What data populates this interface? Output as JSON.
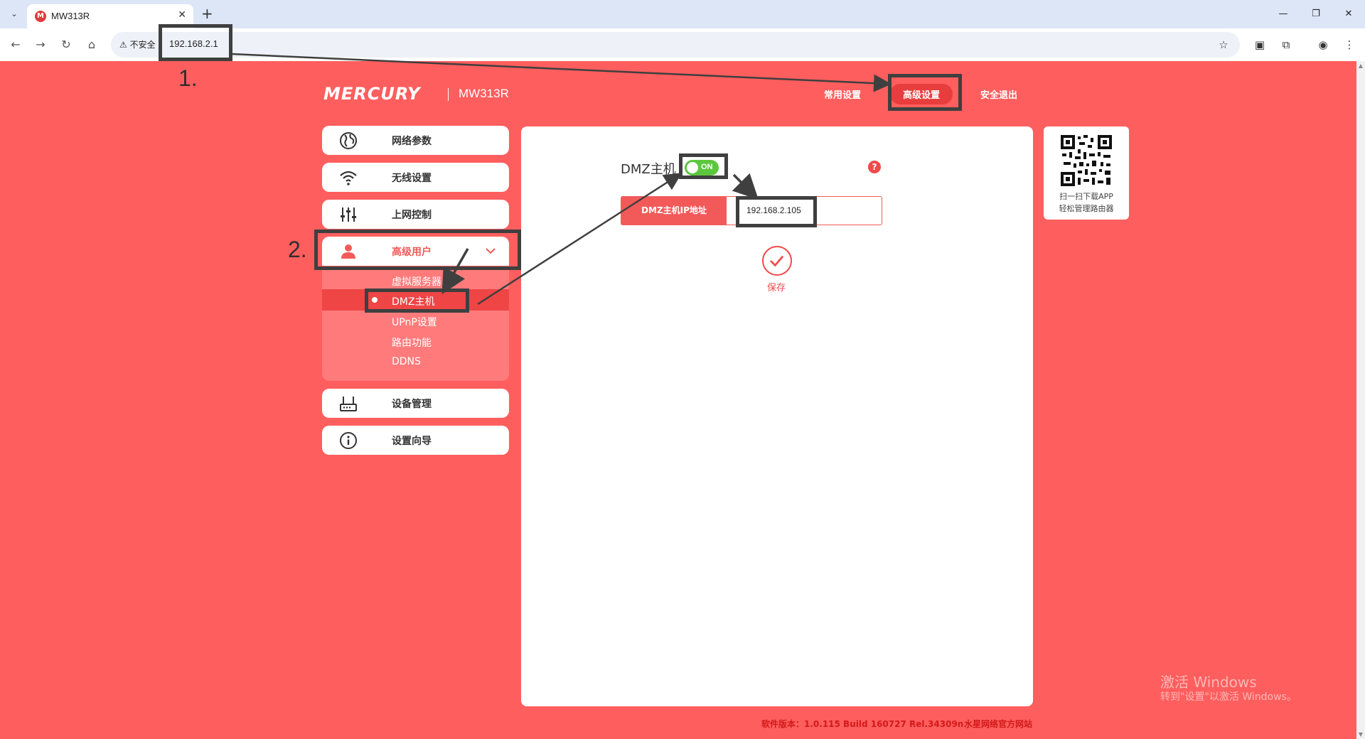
{
  "browser": {
    "tab_title": "MW313R",
    "favicon_letter": "M",
    "insecure_label": "不安全",
    "url": "192.168.2.1"
  },
  "router": {
    "brand": "MERCURY",
    "model": "MW313R",
    "top_nav": {
      "common": "常用设置",
      "advanced": "高级设置",
      "logout": "安全退出"
    },
    "sidebar": {
      "items": [
        {
          "label": "网络参数",
          "icon": "globe-icon"
        },
        {
          "label": "无线设置",
          "icon": "wifi-icon"
        },
        {
          "label": "上网控制",
          "icon": "sliders-icon"
        },
        {
          "label": "高级用户",
          "icon": "user-icon"
        },
        {
          "label": "设备管理",
          "icon": "router-icon"
        },
        {
          "label": "设置向导",
          "icon": "info-icon"
        }
      ],
      "submenu": [
        "虚拟服务器",
        "DMZ主机",
        "UPnP设置",
        "路由功能",
        "DDNS"
      ]
    },
    "dmz": {
      "title": "DMZ主机",
      "toggle_state": "ON",
      "ip_label": "DMZ主机IP地址",
      "ip_value": "192.168.2.105",
      "save_label": "保存",
      "help_glyph": "?"
    },
    "qr": {
      "line1": "扫一扫下载APP",
      "line2": "轻松管理路由器"
    },
    "footer": {
      "version": "软件版本：1.0.115 Build 160727 Rel.34309n",
      "site": "水星网络官方网站"
    }
  },
  "windows_watermark": {
    "line1": "激活 Windows",
    "line2": "转到\"设置\"以激活 Windows。"
  },
  "annotations": {
    "step1": "1.",
    "step2": "2."
  },
  "colors": {
    "page_bg": "#ff5e5e",
    "accent": "#f25a5a",
    "toggle_on": "#5cc73e",
    "annotation": "#3f3f3f"
  }
}
